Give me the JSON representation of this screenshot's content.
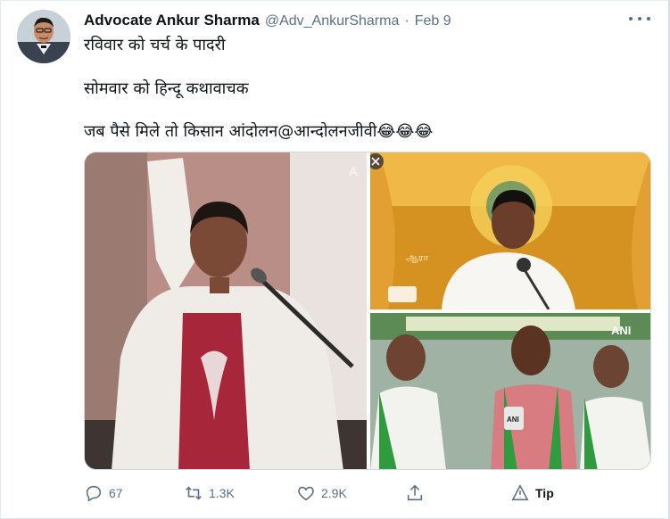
{
  "tweet": {
    "author_name": "Advocate Ankur Sharma",
    "handle": "@Adv_AnkurSharma",
    "separator": "·",
    "date": "Feb 9",
    "lines": [
      "रविवार को चर्च के पादरी",
      "सोमवार को हिन्दू कथावाचक",
      "जब पैसे मिले तो किसान आंदोलन@आन्दोलनजीवी😂😂😂"
    ]
  },
  "media": {
    "photo_right_top_watermark": "ஆரா",
    "photo_right_bottom_logo": "ANI",
    "mic_logo": "ANI",
    "left_badge": "A"
  },
  "actions": {
    "replies": "67",
    "retweets": "1.3K",
    "likes": "2.9K",
    "tip_label": "Tip"
  },
  "colors": {
    "text_primary": "#0f1419",
    "text_secondary": "#5b7083",
    "border": "#cfd9de"
  },
  "icons": [
    "more-icon",
    "reply-icon",
    "retweet-icon",
    "like-icon",
    "share-icon",
    "tip-icon"
  ]
}
